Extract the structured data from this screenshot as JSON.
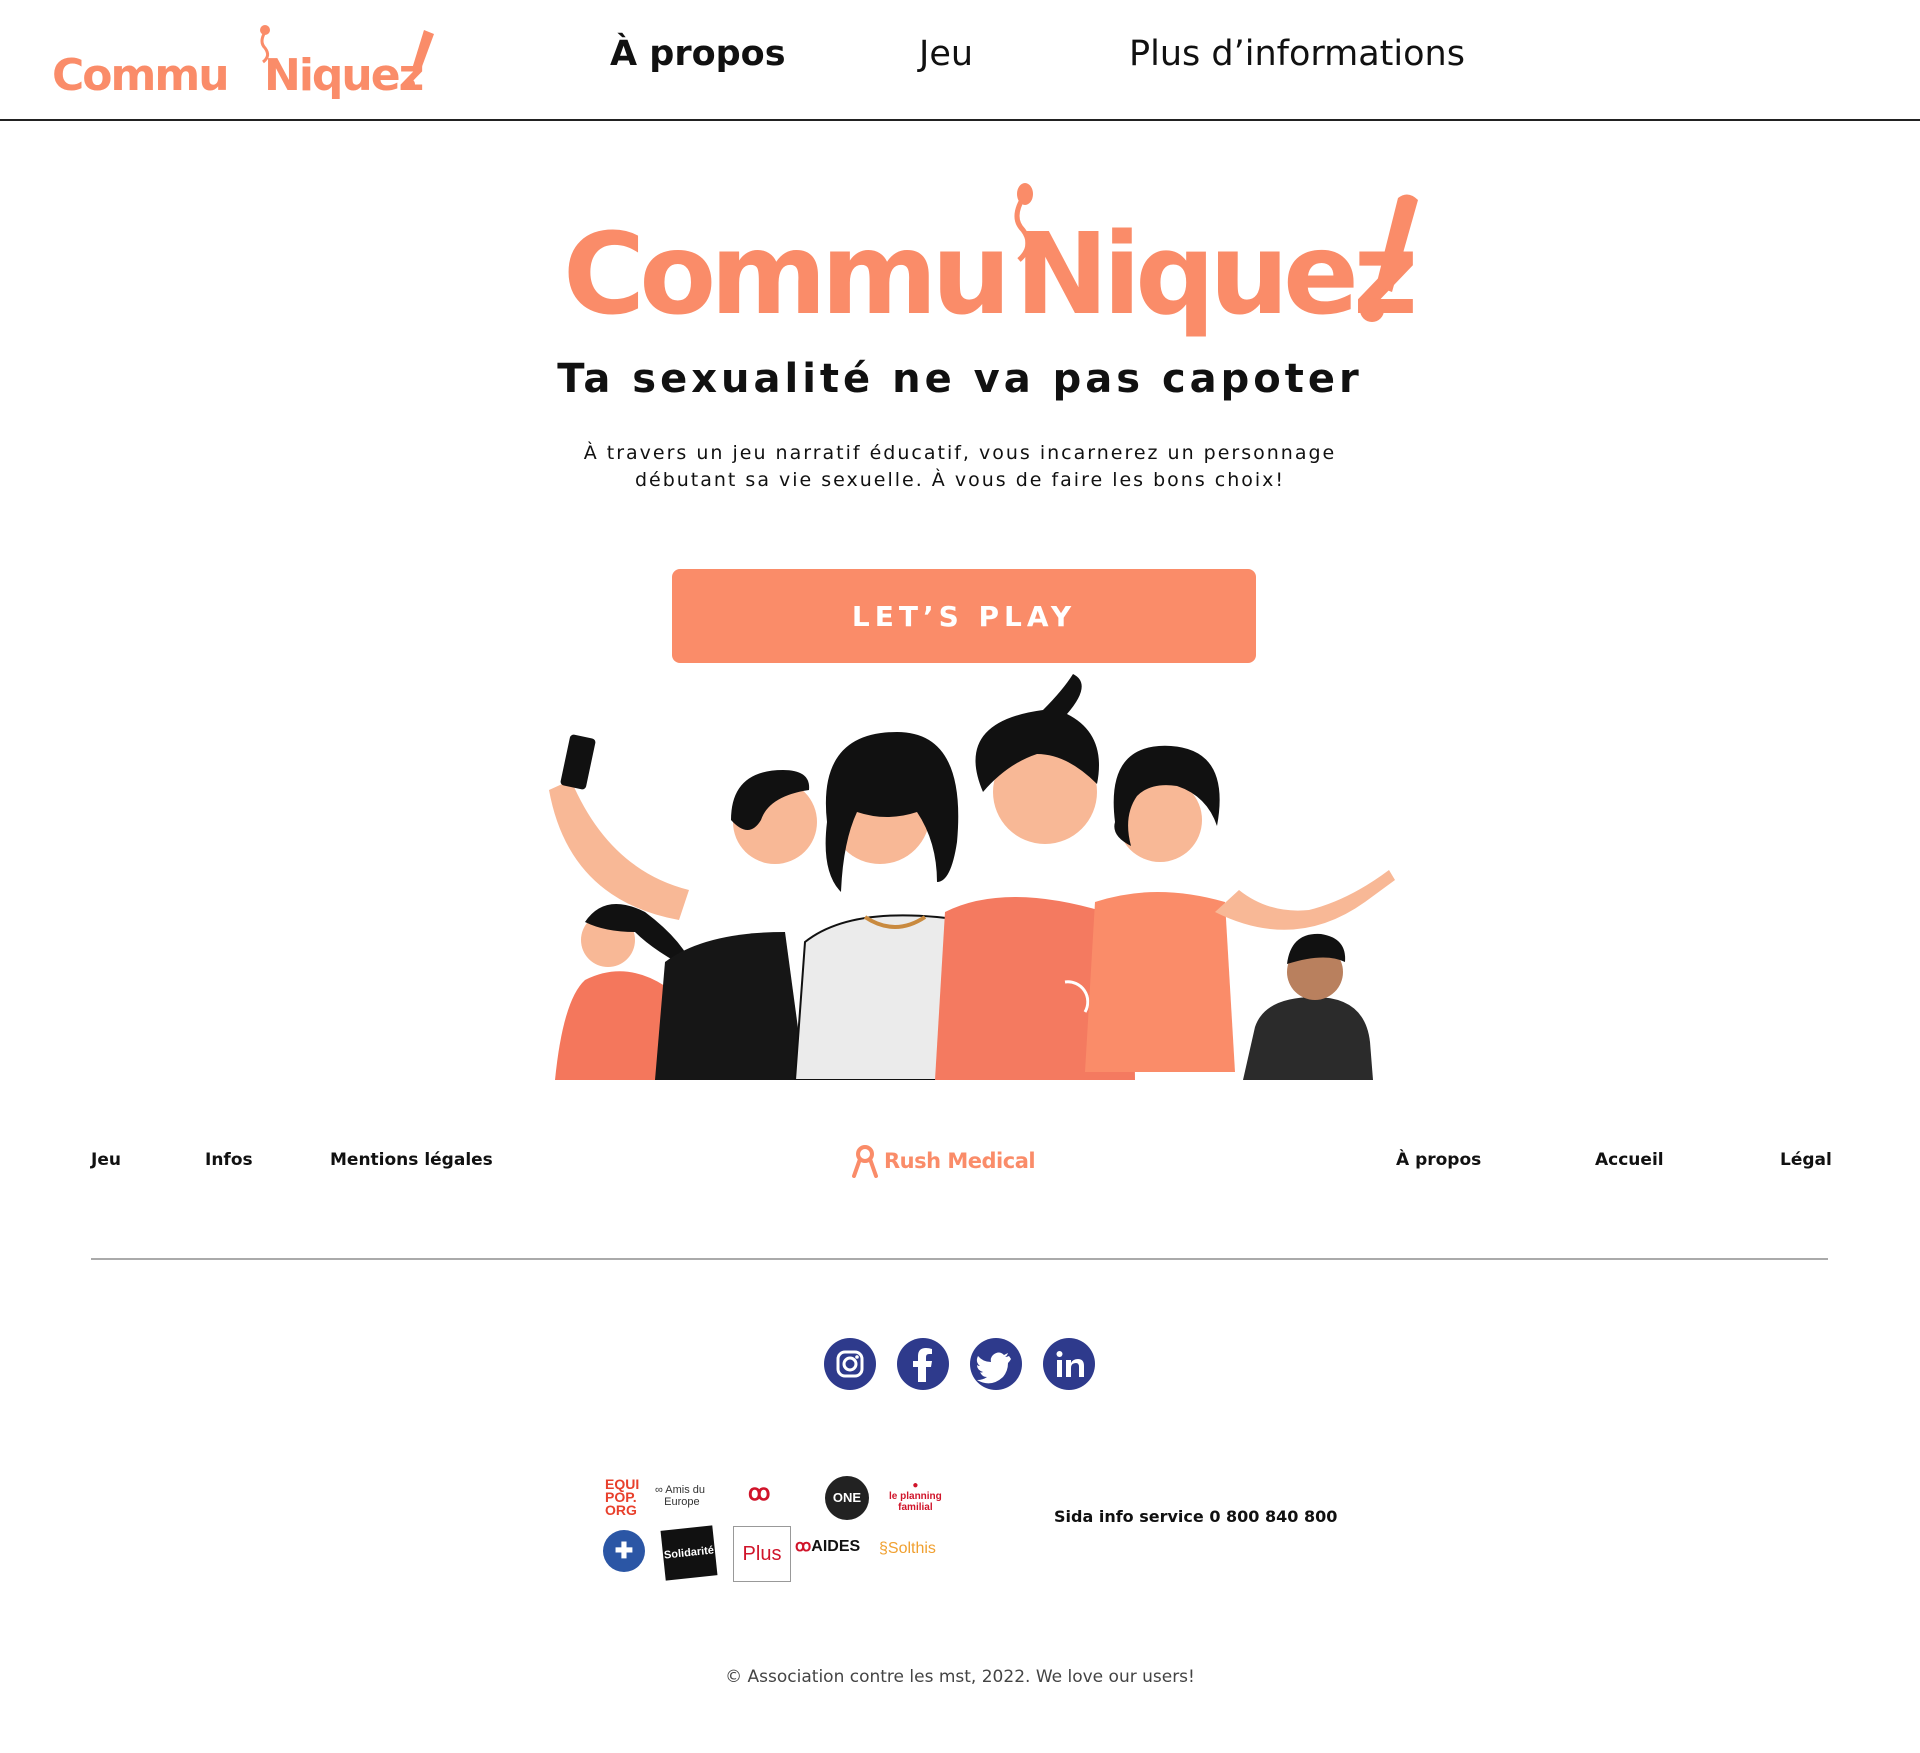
{
  "brand": {
    "name": "Commu'Niquez!",
    "accent_color": "#fa8c69"
  },
  "header": {
    "nav": [
      {
        "label": "À propos",
        "active": true
      },
      {
        "label": "Jeu",
        "active": false
      },
      {
        "label": "Plus d’informations",
        "active": false
      }
    ]
  },
  "hero": {
    "tagline": "Ta sexualité ne va pas capoter",
    "intro_line1": "À travers un jeu narratif éducatif, vous incarnerez un personnage",
    "intro_line2": "débutant sa vie sexuelle. À vous de faire les bons choix!",
    "cta_label": "LET’S PLAY"
  },
  "footer": {
    "left_links": [
      "Jeu",
      "Infos",
      "Mentions légales"
    ],
    "center_brand": "Rush Medical",
    "right_links": [
      "À propos",
      "Accueil",
      "Légal"
    ],
    "social": [
      "instagram-icon",
      "facebook-icon",
      "twitter-icon",
      "linkedin-icon"
    ],
    "partners": [
      "EQUI POP. ORG",
      "Amis du Fonds Mondial Europe",
      "Sidaction",
      "ONE",
      "le planning familial",
      "Médecins du Monde",
      "Solidarité SIDA",
      "Plus",
      "AIDES",
      "Solthis"
    ],
    "hotline": "Sida info service 0 800 840 800",
    "copyright": "© Association contre les mst, 2022. We love our users!"
  }
}
